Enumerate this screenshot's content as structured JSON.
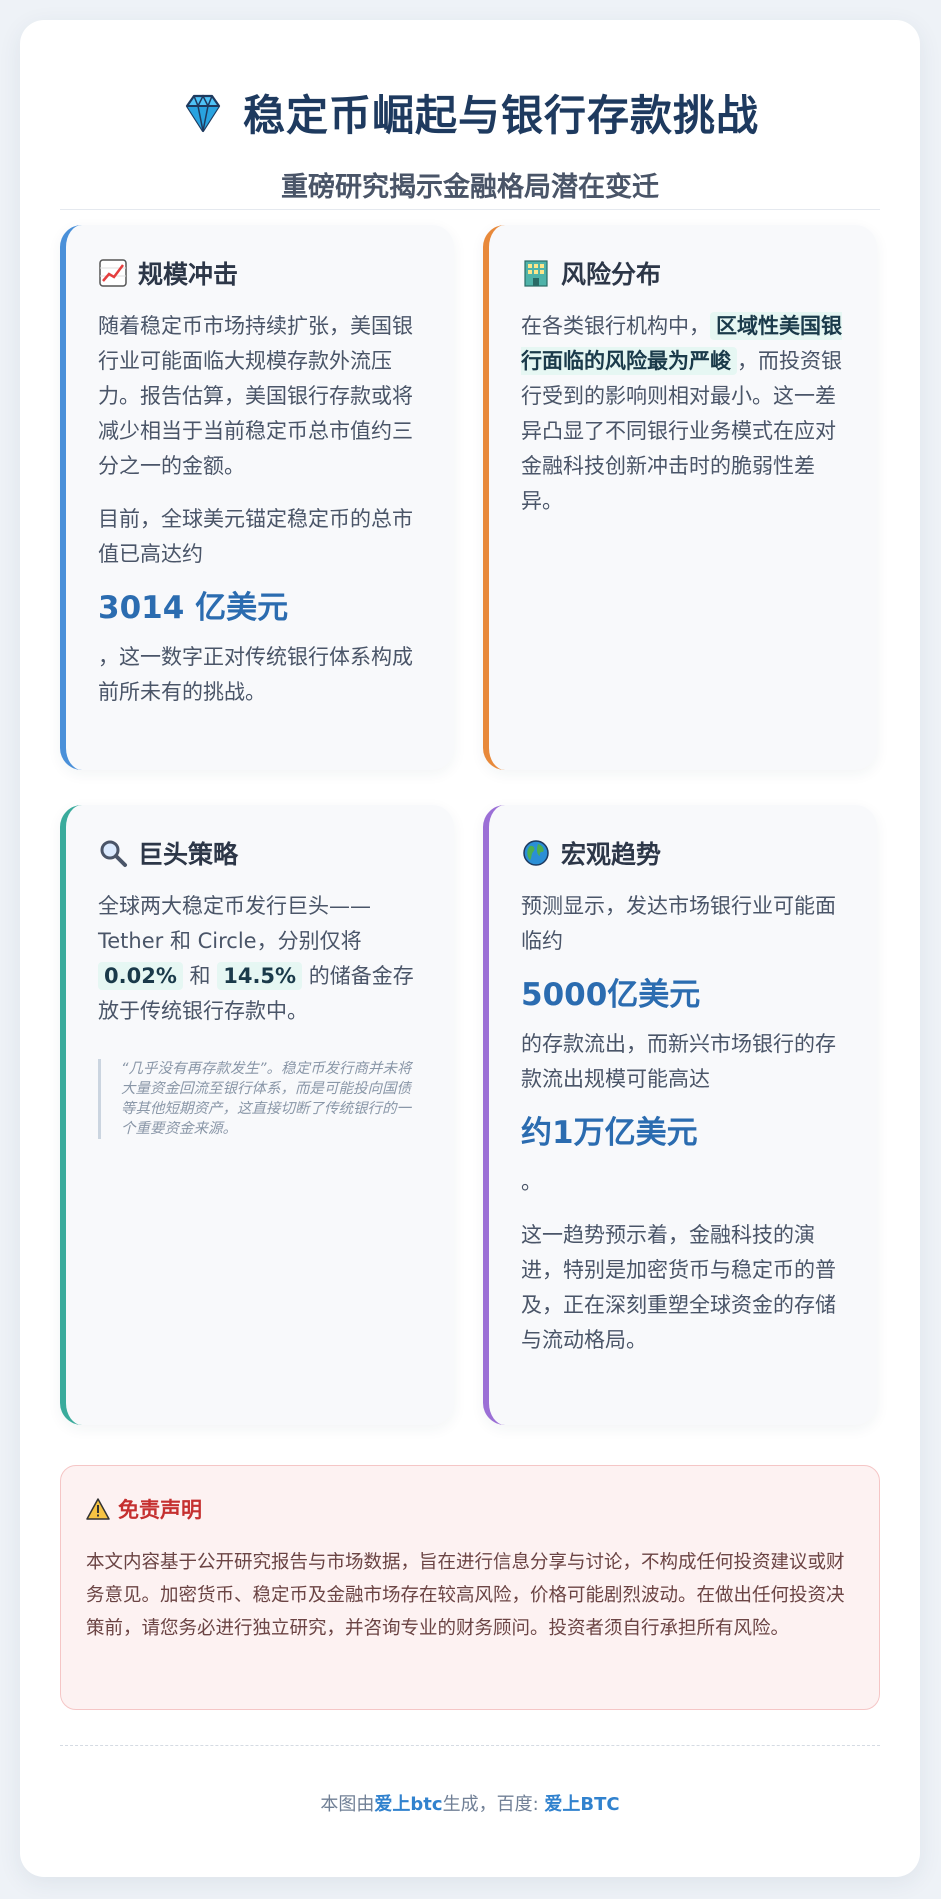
{
  "header": {
    "icon": "gem-icon",
    "title": "稳定币崛起与银行存款挑战",
    "subtitle": "重磅研究揭示金融格局潜在变迁"
  },
  "panels": {
    "scale": {
      "icon": "chart-up-icon",
      "title": "规模冲击",
      "para1": "随着稳定币市场持续扩张，美国银行业可能面临大规模存款外流压力。报告估算，美国银行存款或将减少相当于当前稳定币总市值约三分之一的金额。",
      "para2": "目前，全球美元锚定稳定币的总市值已高达约",
      "figure": "3014 亿美元",
      "para3": "，这一数字正对传统银行体系构成前所未有的挑战。",
      "accent": "#4a90d9"
    },
    "risk": {
      "icon": "building-icon",
      "title": "风险分布",
      "text_before": "在各类银行机构中，",
      "highlight": "区域性美国银行面临的风险最为严峻",
      "text_after": "，而投资银行受到的影响则相对最小。这一差异凸显了不同银行业务模式在应对金融科技创新冲击时的脆弱性差异。",
      "accent": "#e8893a"
    },
    "giants": {
      "icon": "magnifier-icon",
      "title": "巨头策略",
      "text1": "全球两大稳定币发行巨头——Tether 和 Circle，分别仅将",
      "pct1": "0.02%",
      "and": "和",
      "pct2": "14.5%",
      "text2": "的储备金存放于传统银行存款中。",
      "quote": "“几乎没有再存款发生”。稳定币发行商并未将大量资金回流至银行体系，而是可能投向国债等其他短期资产，这直接切断了传统银行的一个重要资金来源。",
      "accent": "#3aab9c"
    },
    "macro": {
      "icon": "globe-icon",
      "title": "宏观趋势",
      "text1": "预测显示，发达市场银行业可能面临约",
      "figure1": "5000亿美元",
      "text2": "的存款流出，而新兴市场银行的存款流出规模可能高达",
      "figure2": "约1万亿美元",
      "text3": "。",
      "text4": "这一趋势预示着，金融科技的演进，特别是加密货币与稳定币的普及，正在深刻重塑全球资金的存储与流动格局。",
      "accent": "#9b6fd6"
    }
  },
  "disclaimer": {
    "icon": "warning-icon",
    "title": "免责声明",
    "text": "本文内容基于公开研究报告与市场数据，旨在进行信息分享与讨论，不构成任何投资建议或财务意见。加密货币、稳定币及金融市场存在较高风险，价格可能剧烈波动。在做出任何投资决策前，请您务必进行独立研究，并咨询专业的财务顾问。投资者须自行承担所有风险。"
  },
  "footer": {
    "prefix": "本图由",
    "brand1": "爱上btc",
    "middle": "生成，百度: ",
    "brand2": "爱上BTC"
  }
}
